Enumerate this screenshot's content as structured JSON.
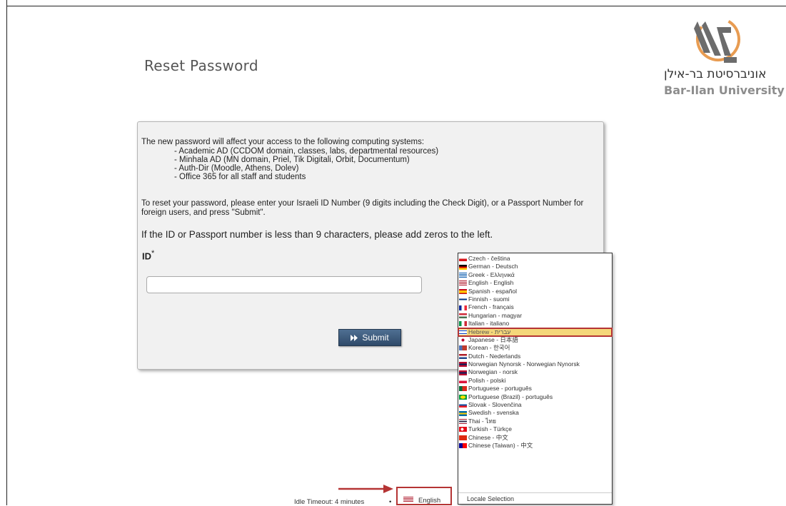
{
  "page": {
    "title": "Reset Password"
  },
  "logo": {
    "hebrew": "אוניברסיטת בר-אילן",
    "english": "Bar-Ilan University"
  },
  "panel": {
    "intro": "The new password will affect your access to the following computing systems:",
    "systems": [
      "- Academic AD (CCDOM domain, classes, labs, departmental resources)",
      "- Minhala AD (MN domain, Priel, Tik Digitali, Orbit, Documentum)",
      "- Auth-Dir (Moodle, Athens, Dolev)",
      "- Office 365 for all staff and students"
    ],
    "reset_instruction": "To reset your password, please enter your Israeli ID Number (9 digits including the Check Digit), or a Passport Number for foreign users, and press \"Submit\".",
    "zero_note": "If the ID or Passport number is less than 9 characters, please add zeros to the left.",
    "id_label": "ID",
    "id_required": "*",
    "id_value": "",
    "submit_label": "Submit"
  },
  "locale_menu": {
    "items": [
      {
        "label": "Czech - čeština",
        "flag": "czech"
      },
      {
        "label": "German - Deutsch",
        "flag": "german"
      },
      {
        "label": "Greek - Ελληνικά",
        "flag": "greek"
      },
      {
        "label": "English - English",
        "flag": "us"
      },
      {
        "label": "Spanish - español",
        "flag": "spanish"
      },
      {
        "label": "Finnish - suomi",
        "flag": "finnish"
      },
      {
        "label": "French - français",
        "flag": "french"
      },
      {
        "label": "Hungarian - magyar",
        "flag": "hungarian"
      },
      {
        "label": "Italian - italiano",
        "flag": "italian"
      },
      {
        "label": "Hebrew - עברית",
        "flag": "israel",
        "highlighted": true
      },
      {
        "label": "Japanese - 日本語",
        "flag": "japan"
      },
      {
        "label": "Korean - 한국어",
        "flag": "korea"
      },
      {
        "label": "Dutch - Nederlands",
        "flag": "dutch"
      },
      {
        "label": "Norwegian Nynorsk - Norwegian Nynorsk",
        "flag": "norway"
      },
      {
        "label": "Norwegian - norsk",
        "flag": "norway"
      },
      {
        "label": "Polish - polski",
        "flag": "poland"
      },
      {
        "label": "Portuguese - português",
        "flag": "portugal"
      },
      {
        "label": "Portuguese (Brazil) - português",
        "flag": "brazil"
      },
      {
        "label": "Slovak - Slovenčina",
        "flag": "slovak"
      },
      {
        "label": "Swedish - svenska",
        "flag": "sweden"
      },
      {
        "label": "Thai - ไทย",
        "flag": "thai"
      },
      {
        "label": "Turkish - Türkçe",
        "flag": "turkey"
      },
      {
        "label": "Chinese - 中文",
        "flag": "china"
      },
      {
        "label": "Chinese (Taiwan) - 中文",
        "flag": "taiwan"
      }
    ],
    "footer": "Locale Selection"
  },
  "footer": {
    "idle_timeout": "Idle Timeout: 4 minutes",
    "separator": "•",
    "language": "English"
  },
  "colors": {
    "accent_red": "#b53434",
    "submit_blue": "#3d5a7c",
    "highlight": "#f5d77a",
    "logo_orange": "#e89c52"
  }
}
